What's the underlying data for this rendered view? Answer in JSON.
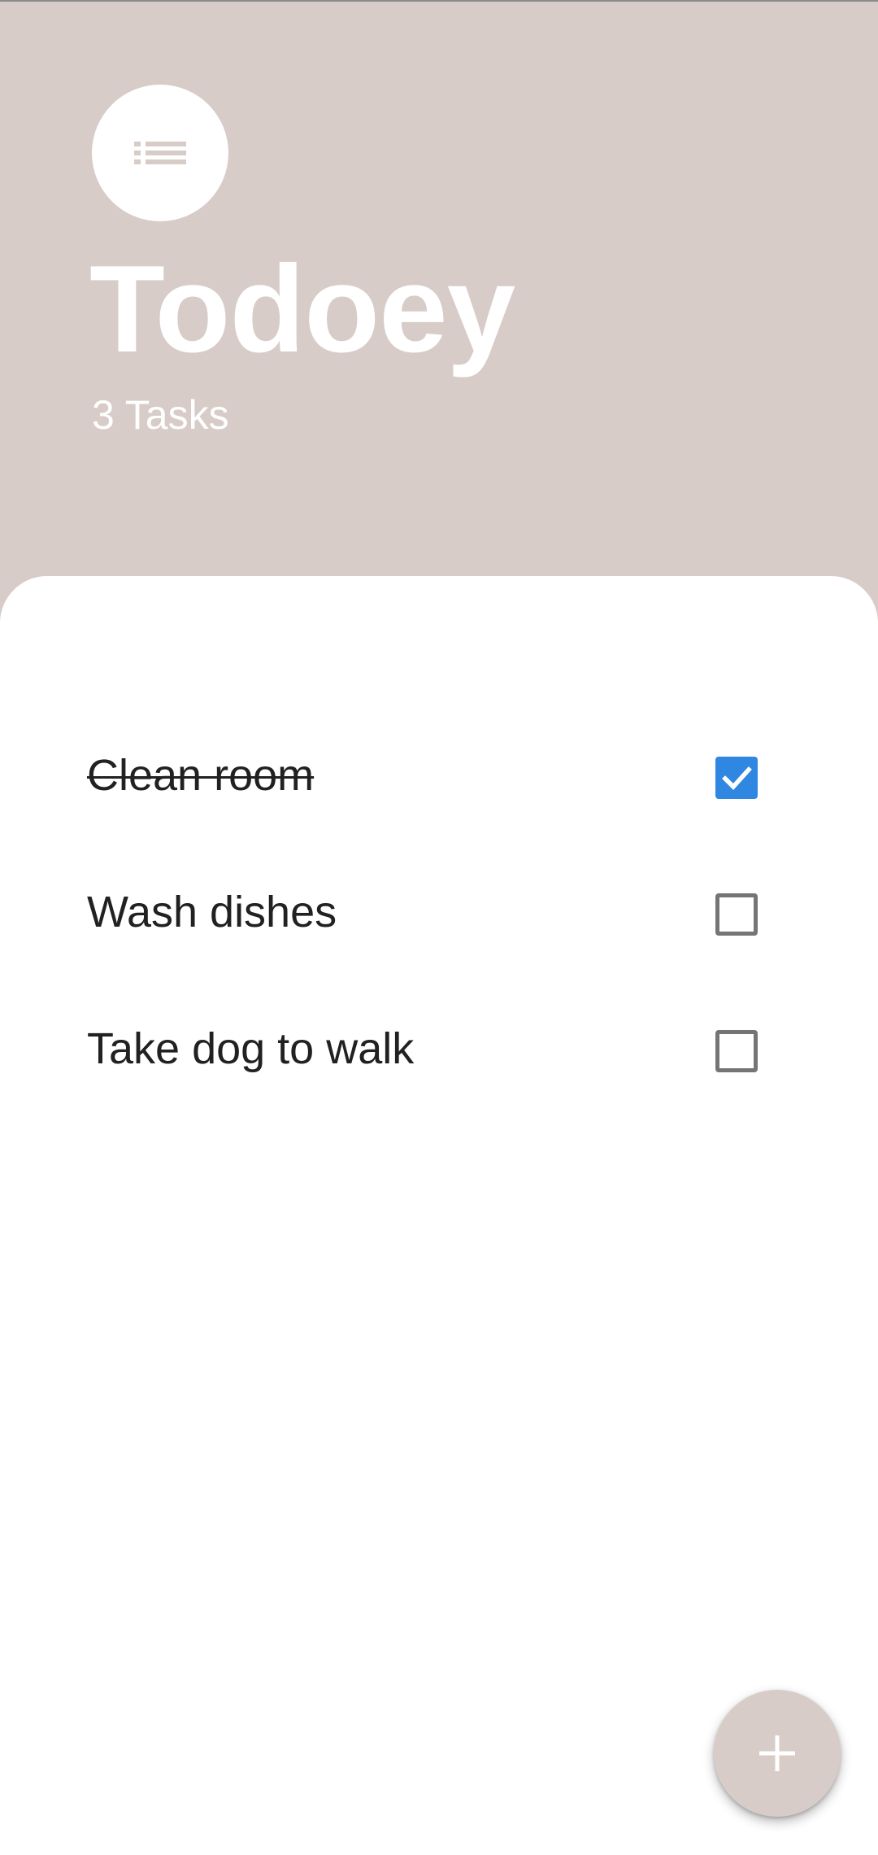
{
  "app": {
    "title": "Todoey",
    "task_count_label": "3 Tasks",
    "logo_icon": "list-icon"
  },
  "tasks": [
    {
      "label": "Clean room",
      "done": true
    },
    {
      "label": "Wash dishes",
      "done": false
    },
    {
      "label": "Take dog to walk",
      "done": false
    }
  ],
  "fab": {
    "icon": "plus-icon"
  },
  "colors": {
    "header_background": "#d7ccc8",
    "sheet_background": "#ffffff",
    "checkbox_checked": "#2f87e2",
    "checkbox_unchecked_border": "#757575",
    "text": "#212121"
  }
}
